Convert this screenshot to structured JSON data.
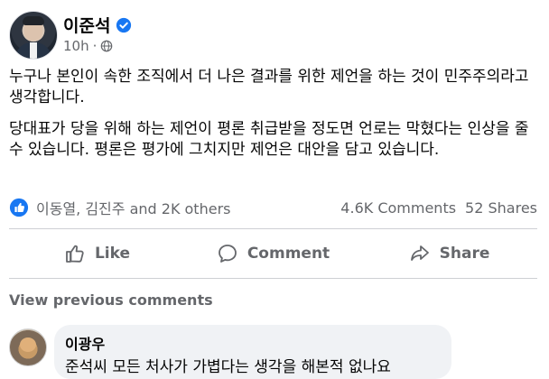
{
  "post": {
    "author": "이준석",
    "time": "10h",
    "dot": "·",
    "paragraphs": [
      "누구나 본인이 속한 조직에서 더 나은 결과를 위한 제언을 하는 것이 민주주의라고 생각합니다.",
      "당대표가 당을 위해 하는 제언이 평론 취급받을 정도면 언로는 막혔다는 인상을 줄 수 있습니다. 평론은 평가에 그치지만 제언은 대안을 담고 있습니다."
    ]
  },
  "reactions": {
    "names": "이동열, 김진주 and 2K others",
    "comments": "4.6K Comments",
    "shares": "52 Shares"
  },
  "actions": {
    "like": "Like",
    "comment": "Comment",
    "share": "Share"
  },
  "comments": {
    "view_previous": "View previous comments",
    "items": [
      {
        "name": "이광우",
        "text": "준석씨 모든 처사가 가볍다는 생각을 해본적 없나요"
      }
    ]
  },
  "colors": {
    "brand_blue": "#1877f2",
    "muted": "#65676b",
    "bubble": "#f0f2f5"
  }
}
